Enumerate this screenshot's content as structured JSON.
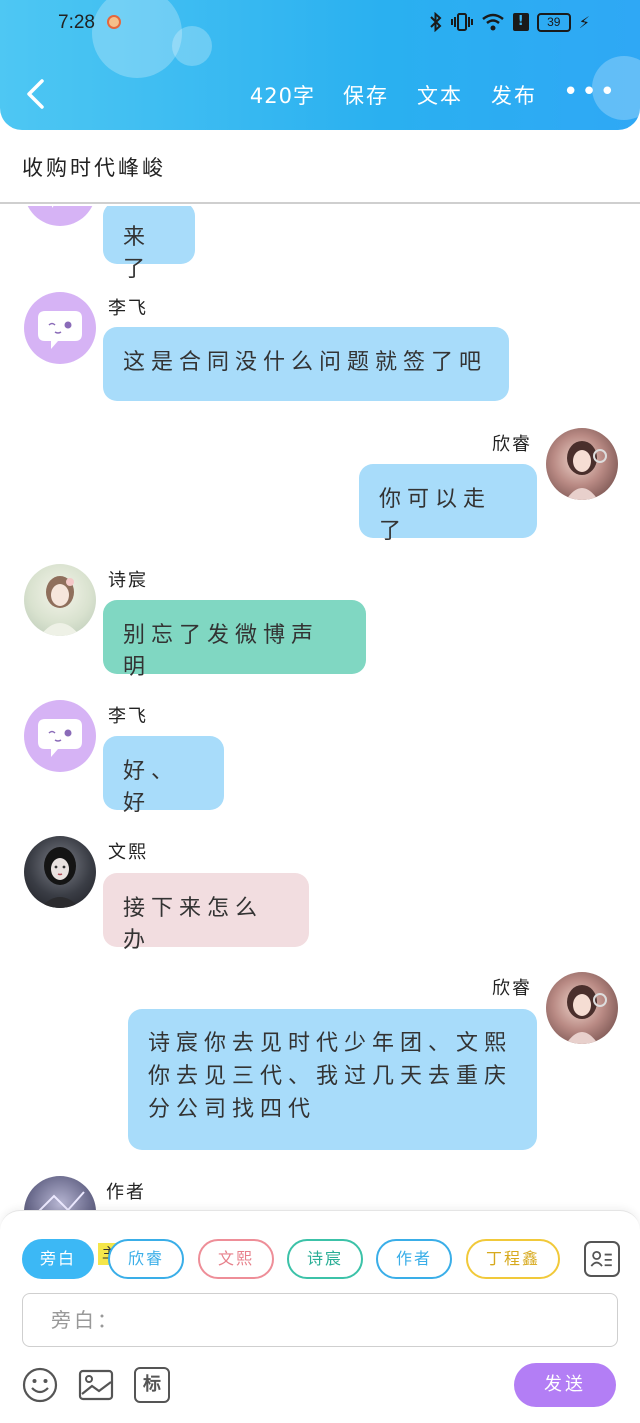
{
  "status_bar": {
    "time": "7:28",
    "battery": "39"
  },
  "header": {
    "word_count": "420字",
    "save_label": "保存",
    "text_label": "文本",
    "publish_label": "发布",
    "more_label": "•••"
  },
  "title": "收购时代峰峻",
  "messages": [
    {
      "sender": "",
      "text": "来了"
    },
    {
      "sender": "李飞",
      "text": "这是合同没什么问题就签了吧"
    },
    {
      "sender": "欣睿",
      "text": "你可以走了"
    },
    {
      "sender": "诗宸",
      "text": "别忘了发微博声明"
    },
    {
      "sender": "李飞",
      "text": "好、好"
    },
    {
      "sender": "文熙",
      "text": "接下来怎么办"
    },
    {
      "sender": "欣睿",
      "text": "诗宸你去见时代少年团、文熙你去见三代、我过几天去重庆分公司找四代"
    },
    {
      "sender": "作者",
      "text": ""
    }
  ],
  "roles": {
    "narrator": "旁白",
    "main_badge": "主",
    "xinrui": "欣睿",
    "wenxi": "文熙",
    "shichen": "诗宸",
    "author": "作者",
    "dingchengxin": "丁程鑫"
  },
  "input": {
    "placeholder": "旁白："
  },
  "toolbar": {
    "mark_label": "标",
    "send_label": "发送"
  },
  "colors": {
    "header_blue": "#2ab0f0",
    "bubble_blue": "#a8dcfa",
    "bubble_teal": "#80d7c2",
    "bubble_pink": "#f2dde0",
    "send_purple": "#b37ef5",
    "narrator_chip": "#3cb8f5"
  }
}
